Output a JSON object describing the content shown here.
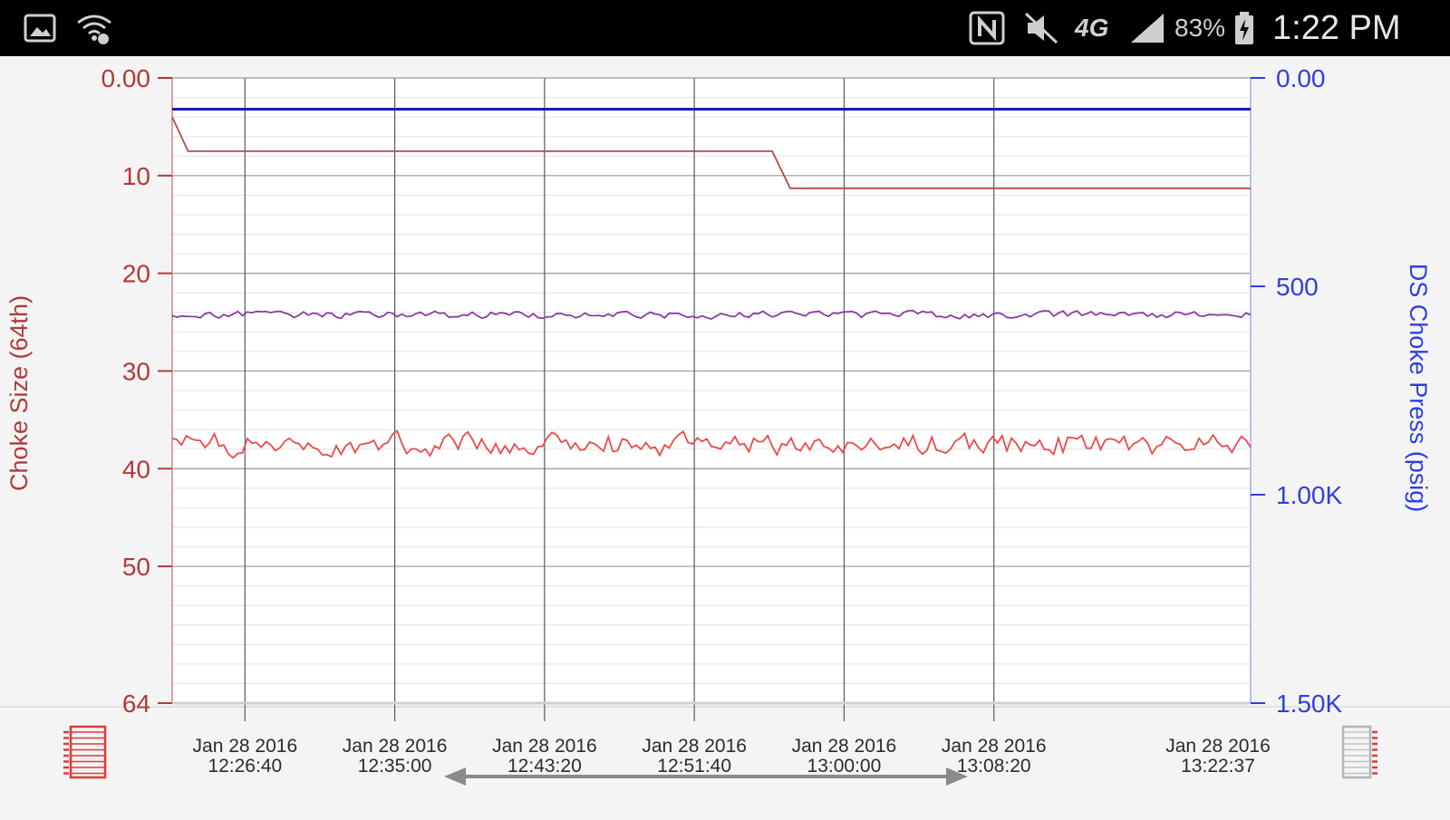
{
  "status_bar": {
    "icons": [
      "gallery-icon",
      "wifi-icon",
      "nfc-icon",
      "mute-icon",
      "lte-icon",
      "signal-icon",
      "battery-icon"
    ],
    "network_label": "4G",
    "battery": "83%",
    "time": "1:22 PM"
  },
  "chart_data": {
    "type": "line",
    "x": [
      "Jan 28 2016 12:26:40",
      "Jan 28 2016 12:35:00",
      "Jan 28 2016 12:43:20",
      "Jan 28 2016 12:51:40",
      "Jan 28 2016 13:00:00",
      "Jan 28 2016 13:08:20",
      "Jan 28 2016 13:22:37"
    ],
    "x_start": "Jan 28 2016 12:22:37",
    "x_end": "Jan 28 2016 13:22:37",
    "x_ticks": [
      {
        "line1": "Jan 28 2016",
        "line2": "12:26:40"
      },
      {
        "line1": "Jan 28 2016",
        "line2": "12:35:00"
      },
      {
        "line1": "Jan 28 2016",
        "line2": "12:43:20"
      },
      {
        "line1": "Jan 28 2016",
        "line2": "12:51:40"
      },
      {
        "line1": "Jan 28 2016",
        "line2": "13:00:00"
      },
      {
        "line1": "Jan 28 2016",
        "line2": "13:08:20"
      },
      {
        "line1": "Jan 28 2016",
        "line2": "13:22:37"
      }
    ],
    "left_axis": {
      "label": "Choke Size (64th)",
      "color": "#b03a3a",
      "ylim": [
        0,
        64
      ],
      "inverted": true,
      "ticks": [
        "0.00",
        "10",
        "20",
        "30",
        "40",
        "50",
        "64"
      ],
      "tick_values": [
        0,
        10,
        20,
        30,
        40,
        50,
        64
      ]
    },
    "right_axis": {
      "label": "DS Choke Press (psig)",
      "color": "#2f3fdc",
      "ylim": [
        0,
        1500
      ],
      "inverted": true,
      "ticks": [
        "0.00",
        "500",
        "1.00K",
        "1.50K"
      ],
      "tick_values": [
        0,
        500,
        1000,
        1500
      ]
    },
    "series": [
      {
        "axis": "right",
        "color": "#1a1ab4",
        "points": [
          [
            "12:22:37",
            75
          ],
          [
            "13:22:37",
            75
          ]
        ]
      },
      {
        "axis": "left",
        "color": "#b44b4b",
        "points": [
          [
            "12:22:37",
            4
          ],
          [
            "12:23:30",
            7.5
          ],
          [
            "12:56:00",
            7.5
          ],
          [
            "12:57:00",
            11.3
          ],
          [
            "13:22:37",
            11.3
          ]
        ]
      },
      {
        "axis": "right",
        "color": "#8a3e9e",
        "noisy": true,
        "base": 568,
        "amplitude": 12
      },
      {
        "axis": "left",
        "color": "#ec4a4a",
        "noisy": true,
        "base": 37.5,
        "amplitude": 1.6
      }
    ],
    "grid": true
  }
}
